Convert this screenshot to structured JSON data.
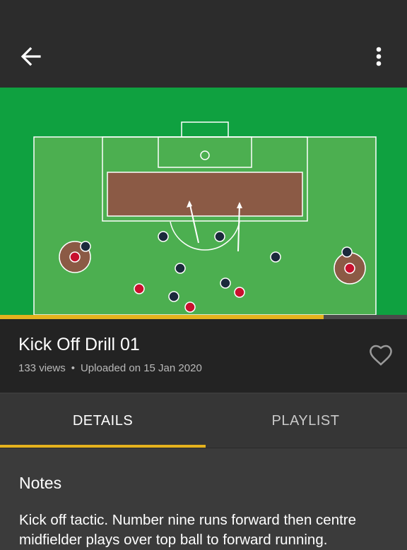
{
  "header": {
    "back_icon": "arrow-left-icon",
    "menu_icon": "more-vertical-icon"
  },
  "video": {
    "progress": 0.795,
    "colors": {
      "pitch": "#0fa140",
      "field": "#4caf50",
      "box": "#8b5a45",
      "team_a": "#c8102e",
      "team_b": "#1b2a3c"
    }
  },
  "drill": {
    "title": "Kick Off Drill 01",
    "views": "133 views",
    "separator": "•",
    "uploaded": "Uploaded on 15 Jan 2020",
    "favorite_icon": "heart-outline-icon"
  },
  "tabs": [
    {
      "label": "DETAILS",
      "active": true
    },
    {
      "label": "PLAYLIST",
      "active": false
    }
  ],
  "details": {
    "notes_heading": "Notes",
    "notes_text": "Kick off tactic. Number nine runs forward then centre midfielder plays over top ball to forward running."
  },
  "colors": {
    "accent": "#e4b21e",
    "topbar": "#2c2c2c",
    "background": "#3b3b3b"
  }
}
